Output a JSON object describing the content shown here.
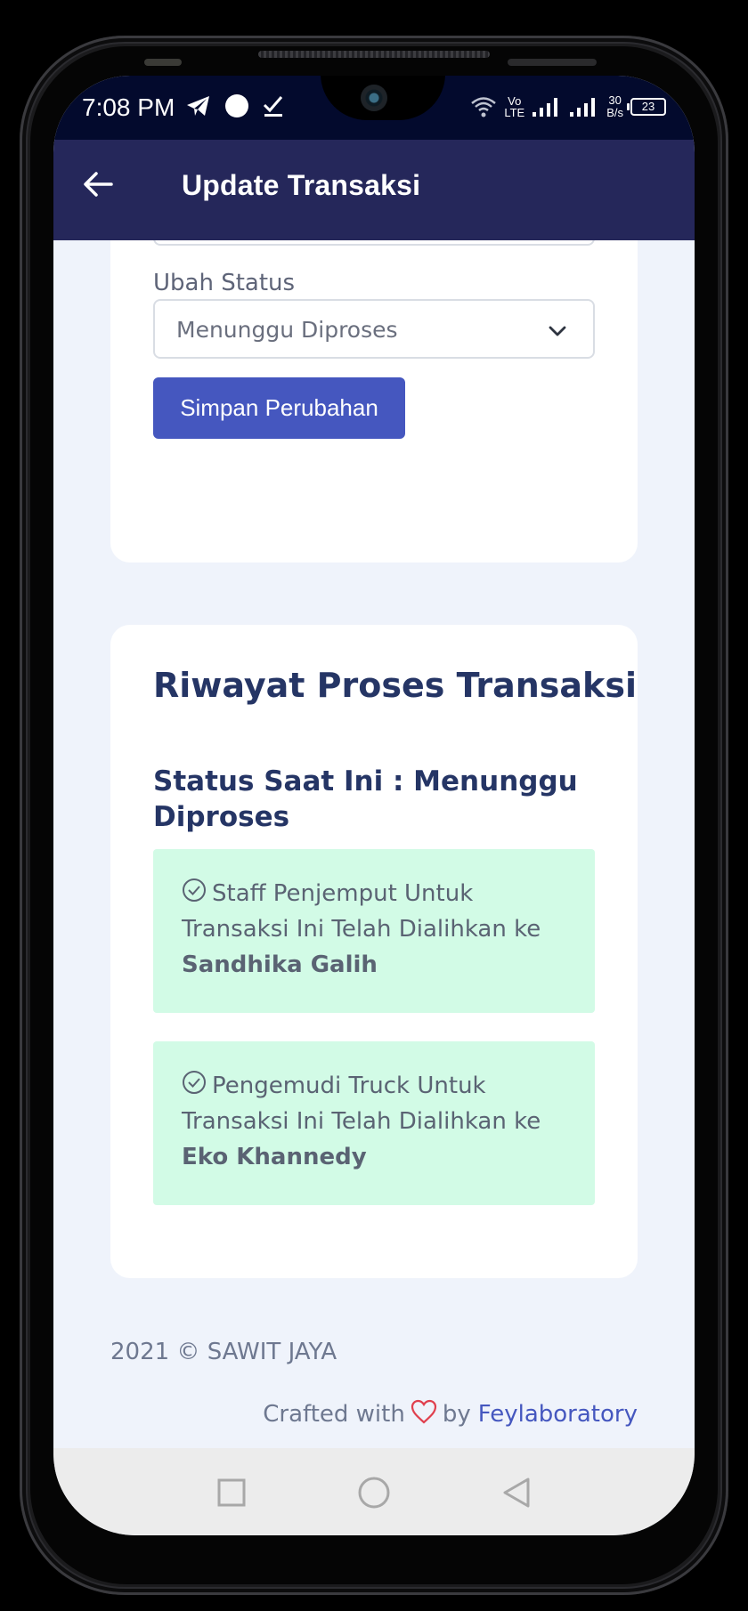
{
  "status_bar": {
    "time": "7:08 PM",
    "network_label_top": "Vo",
    "network_label_bottom": "LTE",
    "speed_value": "30",
    "speed_unit": "B/s",
    "battery": "23"
  },
  "app_bar": {
    "title": "Update Transaksi",
    "back_icon": "arrow-left-icon"
  },
  "update_form": {
    "status_label": "Ubah Status",
    "status_selected": "Menunggu Diproses",
    "save_label": "Simpan Perubahan"
  },
  "history": {
    "title": "Riwayat Proses Transaksi",
    "current_status": "Status Saat Ini : Menunggu Diproses",
    "entries": [
      {
        "icon": "check-circle-icon",
        "text": "Staff Penjemput Untuk Transaksi Ini Telah Dialihkan ke",
        "name": "Sandhika Galih"
      },
      {
        "icon": "check-circle-icon",
        "text": "Pengemudi Truck Untuk Transaksi Ini Telah Dialihkan ke",
        "name": "Eko Khannedy"
      }
    ]
  },
  "footer": {
    "copyright": "2021 © SAWIT JAYA",
    "crafted_prefix": "Crafted with",
    "crafted_by": "by",
    "crafted_brand": "Feylaboratory"
  },
  "colors": {
    "app_bar": "#25275a",
    "status_bar": "#030a2d",
    "primary_button": "#4557bf",
    "alert_bg": "#d2fbe6",
    "heading": "#253565",
    "page_bg": "#eff3fb"
  }
}
